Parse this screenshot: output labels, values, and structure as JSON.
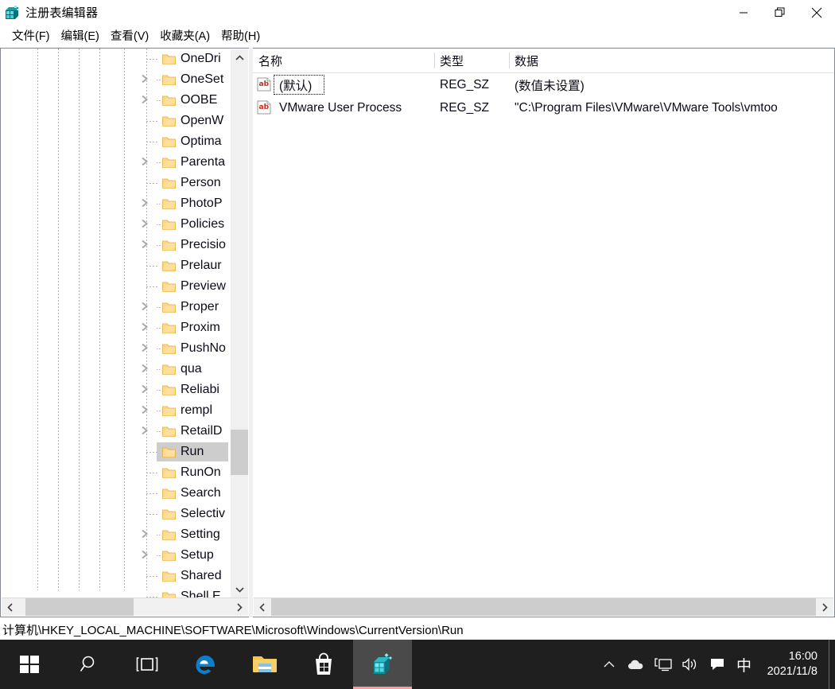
{
  "window": {
    "title": "注册表编辑器",
    "icon": "regedit-icon",
    "controls": {
      "minimize": "最小化",
      "maximize": "还原",
      "close": "关闭"
    }
  },
  "menubar": {
    "items": [
      {
        "label": "文件(F)",
        "name": "menu-file"
      },
      {
        "label": "编辑(E)",
        "name": "menu-edit"
      },
      {
        "label": "查看(V)",
        "name": "menu-view"
      },
      {
        "label": "收藏夹(A)",
        "name": "menu-favorites"
      },
      {
        "label": "帮助(H)",
        "name": "menu-help"
      }
    ]
  },
  "tree": {
    "items": [
      {
        "label": "OneDri",
        "expandable": false,
        "selected": false
      },
      {
        "label": "OneSet",
        "expandable": true,
        "selected": false
      },
      {
        "label": "OOBE",
        "expandable": true,
        "selected": false
      },
      {
        "label": "OpenW",
        "expandable": false,
        "selected": false
      },
      {
        "label": "Optima",
        "expandable": false,
        "selected": false
      },
      {
        "label": "Parenta",
        "expandable": true,
        "selected": false
      },
      {
        "label": "Person",
        "expandable": false,
        "selected": false
      },
      {
        "label": "PhotoP",
        "expandable": true,
        "selected": false
      },
      {
        "label": "Policies",
        "expandable": true,
        "selected": false
      },
      {
        "label": "Precisio",
        "expandable": true,
        "selected": false
      },
      {
        "label": "Prelaur",
        "expandable": false,
        "selected": false
      },
      {
        "label": "Preview",
        "expandable": false,
        "selected": false
      },
      {
        "label": "Proper",
        "expandable": true,
        "selected": false
      },
      {
        "label": "Proxim",
        "expandable": true,
        "selected": false
      },
      {
        "label": "PushNo",
        "expandable": true,
        "selected": false
      },
      {
        "label": "qua",
        "expandable": true,
        "selected": false
      },
      {
        "label": "Reliabi",
        "expandable": true,
        "selected": false
      },
      {
        "label": "rempl",
        "expandable": true,
        "selected": false
      },
      {
        "label": "RetailD",
        "expandable": true,
        "selected": false
      },
      {
        "label": "Run",
        "expandable": false,
        "selected": true
      },
      {
        "label": "RunOn",
        "expandable": false,
        "selected": false
      },
      {
        "label": "Search",
        "expandable": false,
        "selected": false
      },
      {
        "label": "Selectiv",
        "expandable": false,
        "selected": false
      },
      {
        "label": "Setting",
        "expandable": true,
        "selected": false
      },
      {
        "label": "Setup",
        "expandable": true,
        "selected": false
      },
      {
        "label": "Shared",
        "expandable": false,
        "selected": false
      },
      {
        "label": "Shell E",
        "expandable": false,
        "selected": false
      }
    ]
  },
  "list": {
    "columns": [
      {
        "label": "名称",
        "name": "column-name"
      },
      {
        "label": "类型",
        "name": "column-type"
      },
      {
        "label": "数据",
        "name": "column-data"
      }
    ],
    "rows": [
      {
        "name": "(默认)",
        "type": "REG_SZ",
        "data": "(数值未设置)",
        "icon": "string-value-icon",
        "focused": true
      },
      {
        "name": "VMware User Process",
        "type": "REG_SZ",
        "data": "\"C:\\Program Files\\VMware\\VMware Tools\\vmtoo",
        "icon": "string-value-icon",
        "focused": false
      }
    ]
  },
  "statusbar": {
    "path": "计算机\\HKEY_LOCAL_MACHINE\\SOFTWARE\\Microsoft\\Windows\\CurrentVersion\\Run"
  },
  "taskbar": {
    "buttons": [
      {
        "name": "start-button",
        "icon": "windows-logo-icon",
        "active": false
      },
      {
        "name": "search-button",
        "icon": "search-icon",
        "active": false
      },
      {
        "name": "task-view-button",
        "icon": "task-view-icon",
        "active": false
      },
      {
        "name": "edge-button",
        "icon": "edge-icon",
        "active": false
      },
      {
        "name": "file-explorer-button",
        "icon": "folder-icon",
        "active": false
      },
      {
        "name": "microsoft-store-button",
        "icon": "store-bag-icon",
        "active": false
      },
      {
        "name": "registry-editor-button",
        "icon": "regedit-icon",
        "active": true
      }
    ],
    "tray": [
      {
        "name": "tray-expand-button",
        "icon": "chevron-up-icon"
      },
      {
        "name": "onedrive-icon",
        "icon": "cloud-icon"
      },
      {
        "name": "network-icon",
        "icon": "monitor-icon"
      },
      {
        "name": "volume-icon",
        "icon": "speaker-icon"
      },
      {
        "name": "action-center-icon",
        "icon": "speech-bubble-icon"
      },
      {
        "name": "ime-indicator",
        "icon": "ime-chinese-icon",
        "label": "中"
      }
    ],
    "clock": {
      "time": "16:00",
      "date": "2021/11/8"
    }
  },
  "colors": {
    "accent_taskbar": "#1f1f1f",
    "active_underline": "#f2a0a6",
    "selection": "#cdcdcd",
    "folder": "#ffd782",
    "scrollbar_thumb": "#cdcdcd",
    "border": "#828790"
  }
}
